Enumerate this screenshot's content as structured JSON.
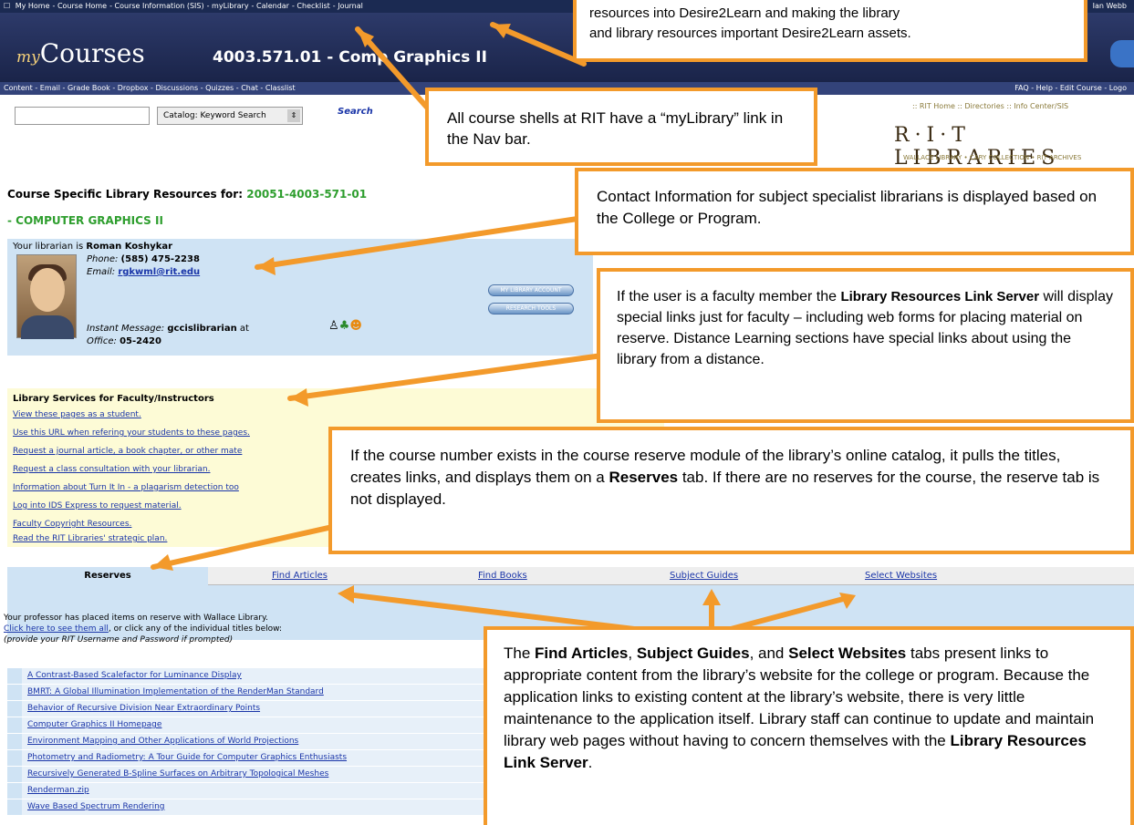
{
  "topbar": {
    "crumbs": [
      "My Home",
      "Course Home",
      "Course Information (SIS)",
      "myLibrary",
      "Calendar",
      "Checklist",
      "Journal"
    ],
    "user": "Ian Webb"
  },
  "header": {
    "logo_prefix": "my",
    "logo_text": "Courses",
    "course_title": "4003.571.01 - Comp Graphics II"
  },
  "navbar": {
    "left": "Content - Email - Grade Book - Dropbox - Discussions - Quizzes - Chat - Classlist",
    "right": "FAQ - Help - Edit Course - Logo"
  },
  "search": {
    "placeholder": "",
    "catalog_option": "Catalog: Keyword Search",
    "button": "Search"
  },
  "rit": {
    "links": ":: RIT Home :: Directories :: Info Center/SIS",
    "logo": "R·I·T LIBRARIES",
    "sub": "WALLACE LIBRARY • CARY COLLECTION • RIT ARCHIVES"
  },
  "course": {
    "heading_prefix": "Course Specific Library Resources for:",
    "heading_code": "20051-4003-571-01",
    "name": "- COMPUTER GRAPHICS II"
  },
  "librarian": {
    "intro": "Your librarian is",
    "name": "Roman Koshykar",
    "phone_label": "Phone:",
    "phone": "(585) 475-2238",
    "email_label": "Email:",
    "email": "rgkwml@rit.edu",
    "im_label": "Instant Message:",
    "im_name": "gccislibrarian",
    "im_at": "at",
    "office_label": "Office:",
    "office": "05-2420",
    "btn_account": "MY LIBRARY ACCOUNT",
    "btn_research": "RESEARCH TOOLS"
  },
  "faculty": {
    "title": "Library Services for Faculty/Instructors",
    "links": [
      "View these pages as a student.",
      "Use this URL when refering your students to these pages.",
      "Request a journal article, a book chapter, or other mate",
      "Request a class consultation with your librarian.",
      "Information about Turn It In - a plagarism detection too",
      "Log into IDS Express to request material.",
      "Faculty Copyright Resources.",
      "Read the RIT Libraries' strategic plan."
    ]
  },
  "tabs": [
    "Reserves",
    "Find Articles",
    "Find Books",
    "Subject Guides",
    "Select Websites"
  ],
  "reserves": {
    "intro": "Your professor has placed items on reserve with Wallace Library.",
    "link": "Click here to see them all",
    "intro2": ", or click any of the individual titles below:",
    "prompt": "(provide your RIT Username and Password if prompted)",
    "items": [
      "A Contrast-Based Scalefactor for Luminance Display",
      "BMRT: A Global Illumination Implementation of the RenderMan Standard",
      "Behavior of Recursive Division Near Extraordinary Points",
      "Computer Graphics II Homepage",
      "Environment Mapping and Other Applications of World Projections",
      "Photometry and Radiometry: A Tour Guide for Computer Graphics Enthusiasts",
      "Recursively Generated B-Spline Surfaces on Arbitrary Topological Meshes",
      "Renderman.zip",
      "Wave Based Spectrum Rendering"
    ]
  },
  "callouts": {
    "top_line1": "resources into Desire2Learn and making the library",
    "top_line2": "and library resources important Desire2Learn assets.",
    "mylib": "All course shells at RIT have a “myLibrary” link in the Nav bar.",
    "contact": "Contact Information for subject specialist librarians is displayed based on the College or Program.",
    "faculty_1": "If the user is a faculty member the ",
    "faculty_b": "Library Resources Link Server",
    "faculty_2": " will display special links just for faculty – including web forms for placing material on reserve. Distance Learning sections have special links about using the library from a distance.",
    "reserve_1": "If the course number exists in the course reserve module of the library’s online catalog, it pulls the titles, creates links, and displays them on a ",
    "reserve_b": "Reserves",
    "reserve_2": " tab. If there are no reserves for the course, the reserve tab is not displayed.",
    "tabs_0": "The ",
    "tabs_b1": "Find Articles",
    "tabs_1": ", ",
    "tabs_b2": "Subject Guides",
    "tabs_2": ", and ",
    "tabs_b3": "Select Websites",
    "tabs_3": " tabs present links to appropriate content from the library’s website for the college or program. Because the application links to existing content at the library’s website, there is very little maintenance to the application itself. Library staff can continue to update and maintain library web pages without having to concern themselves with the ",
    "tabs_b4": "Library Resources Link Server",
    "tabs_4": "."
  },
  "colors": {
    "callout_border": "#f39a2b",
    "arrow": "#f39a2b",
    "link": "#1a35a8",
    "accent_green": "#2e9e2e",
    "panel_blue": "#cfe3f4",
    "panel_yellow": "#fdfbd6"
  }
}
